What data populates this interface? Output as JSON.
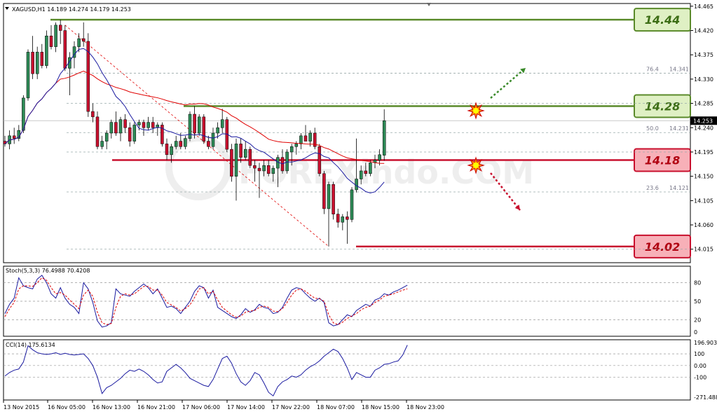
{
  "header": {
    "symbol_line": "XAGUSD,H1  14.189 14.274 14.179 14.253"
  },
  "colors": {
    "bull": "#2e8b57",
    "bear": "#c8102e",
    "support": "#c8102e",
    "resistance": "#5a8a2a",
    "ma_red": "#e00000",
    "ma_blue": "#1a1aa0",
    "sig": "#e00000"
  },
  "chart_data": [
    {
      "type": "candlestick",
      "title": "XAGUSD,H1",
      "ohlc_readout": "14.189 14.274 14.179 14.253",
      "ylim": [
        13.99,
        14.47
      ],
      "y_ticks": [
        "14.465",
        "14.420",
        "14.375",
        "14.330",
        "14.285",
        "14.240",
        "14.195",
        "14.150",
        "14.105",
        "14.060",
        "14.015"
      ],
      "current_price": "14.253",
      "x_tick_labels": [
        "13 Nov 2015",
        "16 Nov 05:00",
        "16 Nov 13:00",
        "16 Nov 21:00",
        "17 Nov 06:00",
        "17 Nov 14:00",
        "17 Nov 22:00",
        "18 Nov 07:00",
        "18 Nov 15:00",
        "18 Nov 23:00"
      ],
      "candles": [
        [
          14.215,
          14.225,
          14.205,
          14.21
        ],
        [
          14.21,
          14.235,
          14.2,
          14.225
        ],
        [
          14.225,
          14.24,
          14.21,
          14.22
        ],
        [
          14.22,
          14.245,
          14.215,
          14.235
        ],
        [
          14.235,
          14.3,
          14.23,
          14.295
        ],
        [
          14.295,
          14.385,
          14.29,
          14.38
        ],
        [
          14.38,
          14.41,
          14.33,
          14.34
        ],
        [
          14.34,
          14.39,
          14.33,
          14.38
        ],
        [
          14.38,
          14.395,
          14.35,
          14.355
        ],
        [
          14.355,
          14.42,
          14.35,
          14.41
        ],
        [
          14.41,
          14.43,
          14.385,
          14.39
        ],
        [
          14.39,
          14.435,
          14.38,
          14.43
        ],
        [
          14.43,
          14.44,
          14.395,
          14.42
        ],
        [
          14.42,
          14.43,
          14.345,
          14.35
        ],
        [
          14.35,
          14.38,
          14.3,
          14.37
        ],
        [
          14.37,
          14.4,
          14.35,
          14.39
        ],
        [
          14.39,
          14.415,
          14.38,
          14.405
        ],
        [
          14.405,
          14.435,
          14.39,
          14.4
        ],
        [
          14.4,
          14.415,
          14.26,
          14.27
        ],
        [
          14.27,
          14.285,
          14.25,
          14.26
        ],
        [
          14.26,
          14.27,
          14.2,
          14.205
        ],
        [
          14.205,
          14.225,
          14.2,
          14.215
        ],
        [
          14.215,
          14.235,
          14.2,
          14.23
        ],
        [
          14.23,
          14.255,
          14.22,
          14.25
        ],
        [
          14.25,
          14.27,
          14.225,
          14.23
        ],
        [
          14.23,
          14.26,
          14.215,
          14.255
        ],
        [
          14.255,
          14.265,
          14.23,
          14.24
        ],
        [
          14.24,
          14.25,
          14.205,
          14.215
        ],
        [
          14.215,
          14.25,
          14.21,
          14.245
        ],
        [
          14.245,
          14.255,
          14.235,
          14.25
        ],
        [
          14.25,
          14.255,
          14.225,
          14.24
        ],
        [
          14.24,
          14.26,
          14.235,
          14.25
        ],
        [
          14.25,
          14.26,
          14.23,
          14.24
        ],
        [
          14.24,
          14.25,
          14.225,
          14.245
        ],
        [
          14.245,
          14.25,
          14.205,
          14.21
        ],
        [
          14.21,
          14.22,
          14.18,
          14.19
        ],
        [
          14.19,
          14.21,
          14.175,
          14.205
        ],
        [
          14.205,
          14.225,
          14.2,
          14.215
        ],
        [
          14.215,
          14.23,
          14.2,
          14.205
        ],
        [
          14.205,
          14.225,
          14.2,
          14.22
        ],
        [
          14.22,
          14.27,
          14.215,
          14.265
        ],
        [
          14.265,
          14.28,
          14.22,
          14.23
        ],
        [
          14.23,
          14.265,
          14.225,
          14.26
        ],
        [
          14.26,
          14.265,
          14.21,
          14.215
        ],
        [
          14.215,
          14.225,
          14.2,
          14.205
        ],
        [
          14.205,
          14.24,
          14.2,
          14.23
        ],
        [
          14.23,
          14.25,
          14.22,
          14.24
        ],
        [
          14.24,
          14.275,
          14.23,
          14.255
        ],
        [
          14.255,
          14.26,
          14.195,
          14.2
        ],
        [
          14.2,
          14.21,
          14.14,
          14.15
        ],
        [
          14.15,
          14.22,
          14.105,
          14.21
        ],
        [
          14.21,
          14.22,
          14.175,
          14.185
        ],
        [
          14.185,
          14.215,
          14.18,
          14.2
        ],
        [
          14.2,
          14.205,
          14.165,
          14.17
        ],
        [
          14.17,
          14.18,
          14.14,
          14.165
        ],
        [
          14.165,
          14.175,
          14.11,
          14.16
        ],
        [
          14.16,
          14.18,
          14.15,
          14.17
        ],
        [
          14.17,
          14.18,
          14.15,
          14.155
        ],
        [
          14.155,
          14.17,
          14.14,
          14.165
        ],
        [
          14.165,
          14.19,
          14.13,
          14.185
        ],
        [
          14.185,
          14.2,
          14.155,
          14.16
        ],
        [
          14.16,
          14.2,
          14.155,
          14.195
        ],
        [
          14.195,
          14.21,
          14.17,
          14.205
        ],
        [
          14.205,
          14.215,
          14.19,
          14.21
        ],
        [
          14.21,
          14.23,
          14.2,
          14.225
        ],
        [
          14.225,
          14.245,
          14.215,
          14.215
        ],
        [
          14.215,
          14.235,
          14.205,
          14.23
        ],
        [
          14.23,
          14.24,
          14.2,
          14.205
        ],
        [
          14.205,
          14.21,
          14.15,
          14.155
        ],
        [
          14.155,
          14.16,
          14.08,
          14.09
        ],
        [
          14.09,
          14.14,
          14.02,
          14.135
        ],
        [
          14.135,
          14.14,
          14.07,
          14.08
        ],
        [
          14.08,
          14.09,
          14.055,
          14.065
        ],
        [
          14.065,
          14.08,
          14.05,
          14.075
        ],
        [
          14.075,
          14.085,
          14.025,
          14.07
        ],
        [
          14.07,
          14.13,
          14.065,
          14.125
        ],
        [
          14.125,
          14.22,
          14.12,
          14.145
        ],
        [
          14.145,
          14.17,
          14.135,
          14.16
        ],
        [
          14.16,
          14.175,
          14.15,
          14.155
        ],
        [
          14.155,
          14.18,
          14.15,
          14.175
        ],
        [
          14.175,
          14.19,
          14.165,
          14.18
        ],
        [
          14.18,
          14.2,
          14.17,
          14.19
        ],
        [
          14.189,
          14.274,
          14.179,
          14.253
        ]
      ],
      "levels": [
        {
          "label": "14.44",
          "price": 14.44,
          "kind": "resistance"
        },
        {
          "label": "14.28",
          "price": 14.28,
          "kind": "resistance"
        },
        {
          "label": "14.18",
          "price": 14.18,
          "kind": "support"
        },
        {
          "label": "14.02",
          "price": 14.02,
          "kind": "support"
        }
      ],
      "fibonacci": [
        {
          "ratio": "76.4",
          "price": "14.341"
        },
        {
          "ratio": "50.0",
          "price": "14.231"
        },
        {
          "ratio": "23.6",
          "price": "14.121"
        }
      ]
    },
    {
      "type": "line",
      "title": "Stoch(5,3,3) 76.4988 70.4208",
      "ylim": [
        0,
        100
      ],
      "y_ticks": [
        "80",
        "50",
        "20",
        "0"
      ],
      "series": [
        {
          "name": "main",
          "values": [
            30,
            45,
            55,
            88,
            75,
            72,
            70,
            86,
            92,
            80,
            62,
            55,
            72,
            55,
            45,
            40,
            30,
            80,
            70,
            48,
            18,
            8,
            10,
            15,
            70,
            62,
            60,
            58,
            66,
            72,
            78,
            72,
            62,
            70,
            55,
            40,
            42,
            38,
            30,
            40,
            50,
            66,
            75,
            72,
            55,
            68,
            40,
            35,
            30,
            25,
            22,
            28,
            38,
            32,
            36,
            45,
            40,
            38,
            30,
            32,
            40,
            55,
            68,
            72,
            70,
            62,
            55,
            50,
            55,
            48,
            15,
            10,
            12,
            20,
            28,
            25,
            35,
            40,
            45,
            42,
            52,
            55,
            62,
            60,
            65,
            68,
            72,
            76
          ]
        },
        {
          "name": "signal",
          "values": [
            25,
            38,
            48,
            70,
            75,
            75,
            74,
            80,
            88,
            84,
            72,
            62,
            64,
            60,
            52,
            45,
            38,
            60,
            68,
            58,
            32,
            15,
            12,
            14,
            40,
            58,
            62,
            60,
            62,
            68,
            74,
            74,
            68,
            68,
            60,
            48,
            44,
            40,
            34,
            38,
            44,
            56,
            70,
            72,
            62,
            66,
            52,
            40,
            34,
            28,
            24,
            26,
            32,
            34,
            35,
            40,
            42,
            40,
            34,
            33,
            38,
            48,
            60,
            68,
            70,
            66,
            60,
            55,
            54,
            50,
            28,
            15,
            12,
            16,
            22,
            26,
            30,
            36,
            40,
            42,
            48,
            52,
            58,
            60,
            62,
            65,
            68,
            70
          ]
        }
      ]
    },
    {
      "type": "line",
      "title": "CCI(14) 175.6134",
      "ylim": [
        -271.488,
        196.903
      ],
      "y_ticks": [
        "196.903",
        "100",
        "0.00",
        "-100",
        "-271.488"
      ],
      "series": [
        {
          "name": "CCI(14)",
          "values": [
            -90,
            -60,
            -40,
            -30,
            30,
            170,
            135,
            110,
            100,
            95,
            100,
            110,
            95,
            105,
            95,
            90,
            95,
            100,
            60,
            0,
            -100,
            -240,
            -190,
            -170,
            -140,
            -110,
            -70,
            -40,
            -50,
            -30,
            -50,
            -80,
            -120,
            -150,
            -140,
            -50,
            -20,
            10,
            -20,
            -60,
            -110,
            -130,
            -150,
            -170,
            -180,
            -120,
            -30,
            60,
            80,
            20,
            -70,
            -140,
            -170,
            -130,
            -60,
            -80,
            -150,
            -230,
            -260,
            -180,
            -140,
            -120,
            -90,
            -100,
            -80,
            -40,
            -10,
            10,
            40,
            80,
            110,
            140,
            120,
            60,
            -20,
            -120,
            -60,
            -80,
            -100,
            -100,
            -40,
            -20,
            10,
            15,
            30,
            40,
            90,
            175
          ]
        }
      ]
    }
  ]
}
